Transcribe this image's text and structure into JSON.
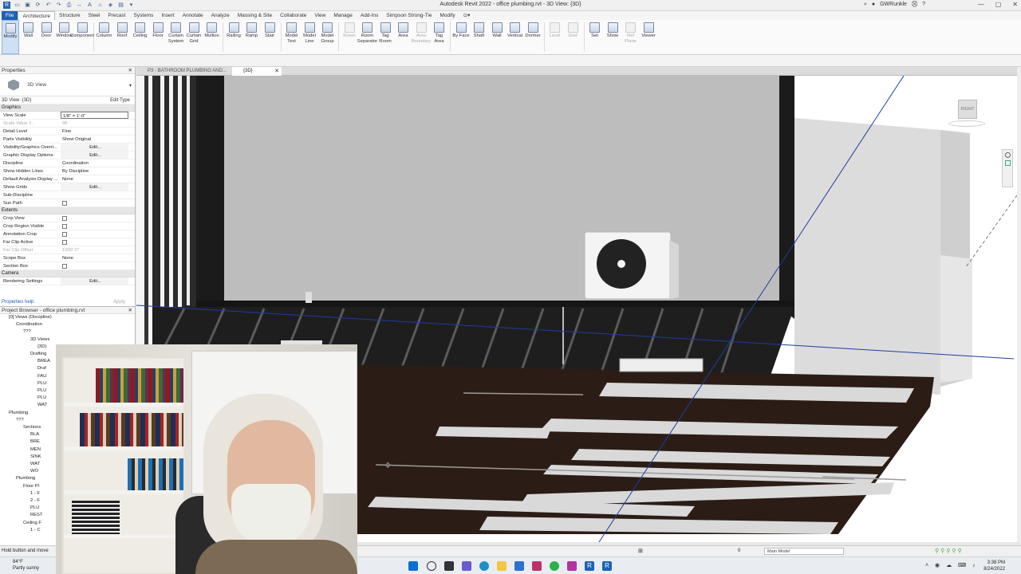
{
  "titlebar": {
    "title": "Autodesk Revit 2022 - office plumbing.rvt - 3D View: {3D}",
    "user": "GWRunkle"
  },
  "menu": {
    "tabs": [
      "File",
      "Architecture",
      "Structure",
      "Steel",
      "Precast",
      "Systems",
      "Insert",
      "Annotate",
      "Analyze",
      "Massing & Site",
      "Collaborate",
      "View",
      "Manage",
      "Add-Ins",
      "Simpson Strong-Tie",
      "Modify"
    ]
  },
  "ribbon": {
    "tools": [
      {
        "label": "Modify",
        "state": "sel"
      },
      {
        "label": "Wall"
      },
      {
        "label": "Door"
      },
      {
        "label": "Window"
      },
      {
        "label": "Component"
      },
      {
        "sep": true
      },
      {
        "label": "Column"
      },
      {
        "label": "Roof"
      },
      {
        "label": "Ceiling"
      },
      {
        "label": "Floor"
      },
      {
        "label": "Curtain System"
      },
      {
        "label": "Curtain Grid"
      },
      {
        "label": "Mullion"
      },
      {
        "sep": true
      },
      {
        "label": "Railing"
      },
      {
        "label": "Ramp"
      },
      {
        "label": "Stair"
      },
      {
        "sep": true
      },
      {
        "label": "Model Text"
      },
      {
        "label": "Model Line"
      },
      {
        "label": "Model Group"
      },
      {
        "sep": true
      },
      {
        "label": "Room",
        "state": "dim"
      },
      {
        "label": "Room Separator"
      },
      {
        "label": "Tag Room"
      },
      {
        "label": "Area"
      },
      {
        "label": "Area Boundary",
        "state": "dim"
      },
      {
        "label": "Tag Area"
      },
      {
        "sep": true
      },
      {
        "label": "By Face"
      },
      {
        "label": "Shaft"
      },
      {
        "label": "Wall"
      },
      {
        "label": "Vertical"
      },
      {
        "label": "Dormer"
      },
      {
        "sep": true
      },
      {
        "label": "Level",
        "state": "dim"
      },
      {
        "label": "Grid",
        "state": "dim"
      },
      {
        "sep": true
      },
      {
        "label": "Set"
      },
      {
        "label": "Show"
      },
      {
        "label": "Ref Plane",
        "state": "dim"
      },
      {
        "label": "Viewer"
      }
    ]
  },
  "viewtabs": [
    {
      "label": "P3 - BATHROOM PLUMBING AND...",
      "active": false
    },
    {
      "label": "{3D}",
      "active": true
    }
  ],
  "properties": {
    "header": "Properties",
    "type": "3D View",
    "filter": "3D View: {3D}",
    "edit_type": "Edit Type",
    "groups": [
      {
        "name": "Graphics",
        "rows": [
          {
            "k": "View Scale",
            "v": "1/8\" = 1'-0\"",
            "kind": "box"
          },
          {
            "k": "Scale Value    1:",
            "v": "96",
            "kind": "dim"
          },
          {
            "k": "Detail Level",
            "v": "Fine"
          },
          {
            "k": "Parts Visibility",
            "v": "Show Original"
          },
          {
            "k": "Visibility/Graphics Overri...",
            "v": "Edit...",
            "kind": "btn"
          },
          {
            "k": "Graphic Display Options",
            "v": "Edit...",
            "kind": "btn"
          },
          {
            "k": "Discipline",
            "v": "Coordination"
          },
          {
            "k": "Show Hidden Lines",
            "v": "By Discipline"
          },
          {
            "k": "Default Analysis Display ...",
            "v": "None"
          },
          {
            "k": "Show Grids",
            "v": "Edit...",
            "kind": "btn"
          },
          {
            "k": "Sub-Discipline",
            "v": ""
          },
          {
            "k": "Sun Path",
            "v": "",
            "kind": "chk"
          }
        ]
      },
      {
        "name": "Extents",
        "rows": [
          {
            "k": "Crop View",
            "v": "",
            "kind": "chk"
          },
          {
            "k": "Crop Region Visible",
            "v": "",
            "kind": "chk"
          },
          {
            "k": "Annotation Crop",
            "v": "",
            "kind": "chk"
          },
          {
            "k": "Far Clip Active",
            "v": "",
            "kind": "chk"
          },
          {
            "k": "Far Clip Offset",
            "v": "1000'  0\"",
            "kind": "dim"
          },
          {
            "k": "Scope Box",
            "v": "None"
          },
          {
            "k": "Section Box",
            "v": "",
            "kind": "chk"
          }
        ]
      },
      {
        "name": "Camera",
        "rows": [
          {
            "k": "Rendering Settings",
            "v": "Edit...",
            "kind": "btn"
          }
        ]
      }
    ],
    "help": "Properties help",
    "apply": "Apply"
  },
  "browser": {
    "header": "Project Browser - office plumbing.rvt",
    "items": [
      {
        "t": "[0] Views (Discipline)",
        "d": 1
      },
      {
        "t": "Coordination",
        "d": 2
      },
      {
        "t": "???",
        "d": 3
      },
      {
        "t": "3D Views",
        "d": 4
      },
      {
        "t": "{3D}",
        "d": 5
      },
      {
        "t": "Drafting",
        "d": 4
      },
      {
        "t": "BREA",
        "d": 5
      },
      {
        "t": "Draf",
        "d": 5
      },
      {
        "t": "FAU",
        "d": 5
      },
      {
        "t": "PLU",
        "d": 5
      },
      {
        "t": "PLU",
        "d": 5
      },
      {
        "t": "PLU",
        "d": 5
      },
      {
        "t": "WAT",
        "d": 5
      },
      {
        "t": "Plumbing",
        "d": 1
      },
      {
        "t": "???",
        "d": 2
      },
      {
        "t": "Sections",
        "d": 3
      },
      {
        "t": "BLA",
        "d": 4
      },
      {
        "t": "BRE",
        "d": 4
      },
      {
        "t": "MEN",
        "d": 4
      },
      {
        "t": "SINK",
        "d": 4
      },
      {
        "t": "WAT",
        "d": 4
      },
      {
        "t": "WO",
        "d": 4
      },
      {
        "t": "Plumbing",
        "d": 2
      },
      {
        "t": "Floor Pl",
        "d": 3
      },
      {
        "t": "1 - F",
        "d": 4
      },
      {
        "t": "2 - F",
        "d": 4
      },
      {
        "t": "PLU",
        "d": 4
      },
      {
        "t": "REST",
        "d": 4
      },
      {
        "t": "Ceiling F",
        "d": 3
      },
      {
        "t": "1 - C",
        "d": 4
      }
    ]
  },
  "status": {
    "left": "Hold button and move",
    "workset": "Main Model",
    "zero": "0"
  },
  "taskbar": {
    "temp": "84°F",
    "weather": "Partly sunny",
    "time": "3:38 PM",
    "date": "8/24/2022"
  },
  "viewcube": {
    "face": "RIGHT"
  },
  "colors": {
    "file_tab": "#1e62b3",
    "ribbon_bg": "#fafafa",
    "section_line": "#1c3fa0",
    "joist": "#2a1a12",
    "cage": "#1a1a1a"
  }
}
